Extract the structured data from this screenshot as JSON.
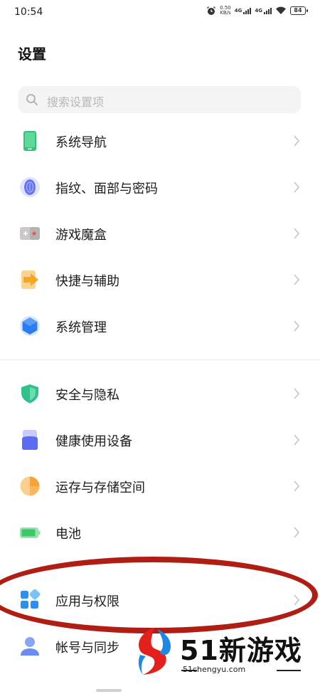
{
  "status_bar": {
    "time": "10:54",
    "speed_value": "0.50",
    "speed_unit": "KB/s",
    "network_1": "4G",
    "network_2": "4G",
    "battery": "84",
    "icons": [
      "alarm-icon",
      "signal-icon",
      "wifi-icon",
      "battery-icon"
    ]
  },
  "header": {
    "title": "设置"
  },
  "search": {
    "placeholder": "搜索设置项"
  },
  "settings": {
    "items": [
      {
        "label": "系统导航",
        "icon": "navigation-phone-icon",
        "color": "#34c27a"
      },
      {
        "label": "指纹、面部与密码",
        "icon": "fingerprint-icon",
        "color": "#5b6cf0"
      },
      {
        "label": "游戏魔盒",
        "icon": "game-box-icon",
        "color": "#e85c5c"
      },
      {
        "label": "快捷与辅助",
        "icon": "shortcut-arrow-icon",
        "color": "#f5a623"
      },
      {
        "label": "系统管理",
        "icon": "system-hexagon-icon",
        "color": "#2b7cf0"
      },
      {
        "label": "安全与隐私",
        "icon": "shield-icon",
        "color": "#2fc28c"
      },
      {
        "label": "健康使用设备",
        "icon": "health-usage-icon",
        "color": "#5b6cf0"
      },
      {
        "label": "运存与存储空间",
        "icon": "storage-pie-icon",
        "color": "#f5a33b"
      },
      {
        "label": "电池",
        "icon": "battery-icon",
        "color": "#3cc768"
      },
      {
        "label": "应用与权限",
        "icon": "apps-grid-icon",
        "color": "#2b8ef0"
      },
      {
        "label": "帐号与同步",
        "icon": "account-person-icon",
        "color": "#6b8cf0"
      }
    ]
  },
  "watermark": {
    "text": "51新游戏",
    "url": "51chengyu.com"
  },
  "colors": {
    "highlight_ring": "#b01d12",
    "chevron": "#c4c4c4"
  }
}
